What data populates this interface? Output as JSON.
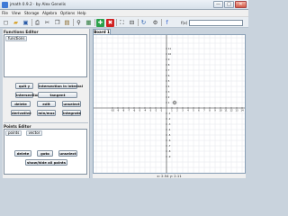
{
  "window": {
    "title": "jmath 0.9.2 · by Alex Genelis",
    "min_glyph": "—",
    "max_glyph": "□",
    "close_glyph": "✕"
  },
  "menu": [
    "File",
    "View",
    "Storage",
    "Algebra",
    "Options",
    "Help"
  ],
  "toolbar": {
    "buttons": [
      {
        "name": "new-file-icon",
        "glyph": "◻",
        "color": "#3a3a3a"
      },
      {
        "name": "open-folder-icon",
        "glyph": "▰",
        "color": "#d7a12a"
      },
      {
        "name": "save-icon",
        "glyph": "▣",
        "color": "#2d5ea8"
      },
      {
        "name": "print-icon",
        "glyph": "⎙",
        "color": "#444444"
      },
      {
        "name": "cut-icon",
        "glyph": "✂",
        "color": "#444444"
      },
      {
        "name": "copy-icon",
        "glyph": "❐",
        "color": "#444444"
      },
      {
        "name": "paste-icon",
        "glyph": "▤",
        "color": "#8a6a2a"
      },
      {
        "name": "zoom-icon",
        "glyph": "⚲",
        "color": "#333333"
      },
      {
        "name": "graph-board-icon",
        "glyph": "▦",
        "color": "#2a7a3a"
      },
      {
        "name": "add-icon",
        "glyph": "✚",
        "color": "#ffffff",
        "bg": "#2aa04a"
      },
      {
        "name": "delete-icon",
        "glyph": "✖",
        "color": "#ffffff",
        "bg": "#d02020"
      },
      {
        "name": "fullscreen-icon",
        "glyph": "⛶",
        "color": "#333333"
      },
      {
        "name": "zoom-out-icon",
        "glyph": "⊟",
        "color": "#333333"
      },
      {
        "name": "refresh-icon",
        "glyph": "↻",
        "color": "#2a60b0"
      },
      {
        "name": "settings-icon",
        "glyph": "⚙",
        "color": "#444444"
      },
      {
        "name": "function-icon",
        "glyph": "f",
        "color": "#2a5bd0"
      }
    ],
    "expr_label": "f(x) =",
    "expr_value": ""
  },
  "functions_editor": {
    "title": "Functions Editor",
    "tabs": [
      "functions"
    ]
  },
  "function_buttons": [
    {
      "label": "quit y",
      "row": 0,
      "col": 0
    },
    {
      "label": "intersection in interval",
      "row": 0,
      "col": 1
    },
    {
      "label": "intersection",
      "row": 1,
      "col": 0
    },
    {
      "label": "tangent",
      "row": 1,
      "col": 1
    },
    {
      "label": "delete",
      "row": 2,
      "col": 0
    },
    {
      "label": "edit",
      "row": 2,
      "col": 1
    },
    {
      "label": "unselect",
      "row": 2,
      "col": 2
    },
    {
      "label": "derivative",
      "row": 3,
      "col": 0
    },
    {
      "label": "min/max",
      "row": 3,
      "col": 1
    },
    {
      "label": "integrate",
      "row": 3,
      "col": 2
    }
  ],
  "points_editor": {
    "title": "Points Editor",
    "tabs": [
      "points",
      "vector"
    ]
  },
  "point_buttons": [
    {
      "label": "delete",
      "row": 0,
      "col": 0
    },
    {
      "label": "goto",
      "row": 0,
      "col": 1
    },
    {
      "label": "unselect",
      "row": 0,
      "col": 2
    },
    {
      "label": "show/hide all points",
      "row": 1,
      "col": 0
    }
  ],
  "board": {
    "tab_label": "Board 1",
    "x_ticks": [
      -10,
      -9,
      -8,
      -7,
      -6,
      -5,
      -4,
      -3,
      -2,
      -1,
      1,
      2,
      3,
      4,
      5,
      6,
      7,
      8,
      9,
      10,
      11,
      12,
      13,
      14
    ],
    "y_ticks": [
      11,
      10,
      9,
      8,
      7,
      6,
      5,
      4,
      3,
      2,
      1,
      -1,
      -2,
      -3,
      -4,
      -5,
      -6,
      -7,
      -8,
      -9
    ],
    "cursor_label": "x: 2.54  y: 2.11"
  }
}
